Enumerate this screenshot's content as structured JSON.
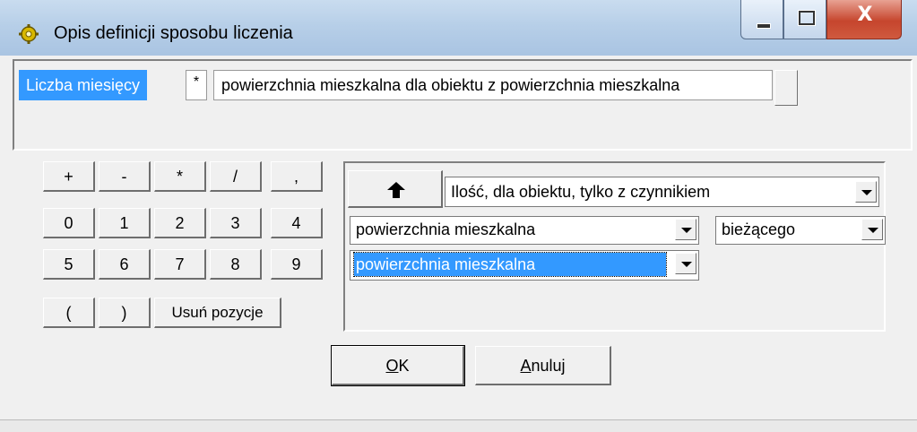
{
  "window": {
    "title": "Opis definicji sposobu liczenia",
    "close_glyph": "X"
  },
  "formula": {
    "chip_1": "Liczba miesięcy",
    "operator": "*",
    "chip_2": "powierzchnia mieszkalna dla obiektu z powierzchnia mieszkalna"
  },
  "keypad": {
    "row1": [
      "+",
      "-",
      "*",
      "/",
      ","
    ],
    "row2": [
      "0",
      "1",
      "2",
      "3",
      "4"
    ],
    "row3": [
      "5",
      "6",
      "7",
      "8",
      "9"
    ],
    "row4": [
      "(",
      ")"
    ],
    "delete_label": "Usuń pozycje"
  },
  "selectors": {
    "quantity_type": "Ilość, dla obiektu, tylko z czynnikiem",
    "parameter": "powierzchnia mieszkalna",
    "period": "bieżącego",
    "factor": "powierzchnia mieszkalna"
  },
  "buttons": {
    "ok_first": "O",
    "ok_rest": "K",
    "cancel_first": "A",
    "cancel_rest": "nuluj"
  },
  "icons": {
    "app": "app-gear-icon",
    "up": "arrow-up-icon",
    "dropdown": "chevron-down-icon"
  },
  "colors": {
    "selection": "#3399ff",
    "close_button": "#c6452d"
  }
}
